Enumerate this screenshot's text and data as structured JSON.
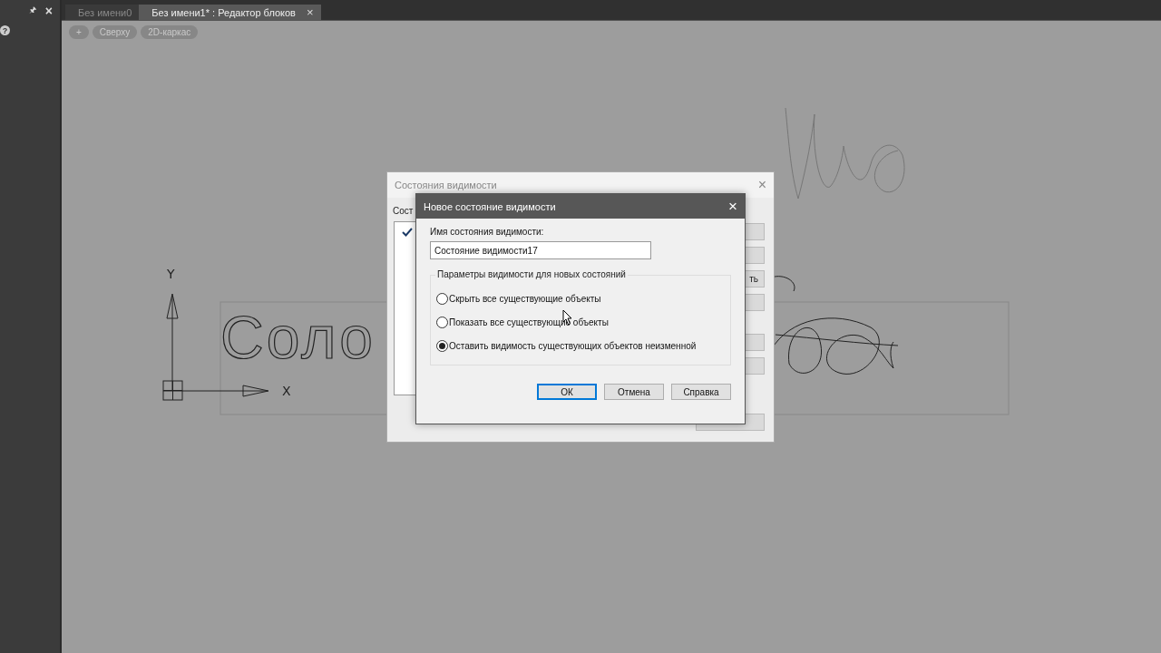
{
  "side_panel": {
    "pin": "🖈",
    "close": "×",
    "help": "?"
  },
  "tabs": [
    {
      "label": "Без имени0",
      "selected": false
    },
    {
      "label": "Без имени1* : Редактор блоков",
      "selected": true,
      "close": "×"
    }
  ],
  "view_controls": [
    "+",
    "Сверху",
    "2D-каркас"
  ],
  "canvas": {
    "drawing_text": "Соло",
    "axis_y": "Y",
    "axis_x": "X"
  },
  "back_dialog": {
    "title": "Состояния видимости",
    "close": "×",
    "label": "Сост",
    "side_button_text": "ть"
  },
  "dialog": {
    "title": "Новое состояние видимости",
    "close": "×",
    "name_label": "Имя состояния видимости:",
    "name_value": "Состояние видимости17",
    "group_title": "Параметры видимости для новых состояний",
    "options": [
      {
        "label": "Скрыть все существующие объекты",
        "selected": false
      },
      {
        "label": "Показать все существующие объекты",
        "selected": false
      },
      {
        "label": "Оставить видимость существующих объектов неизменной",
        "selected": true
      }
    ],
    "buttons": [
      {
        "label": "ОК",
        "default": true
      },
      {
        "label": "Отмена",
        "default": false
      },
      {
        "label": "Справка",
        "default": false
      }
    ]
  }
}
